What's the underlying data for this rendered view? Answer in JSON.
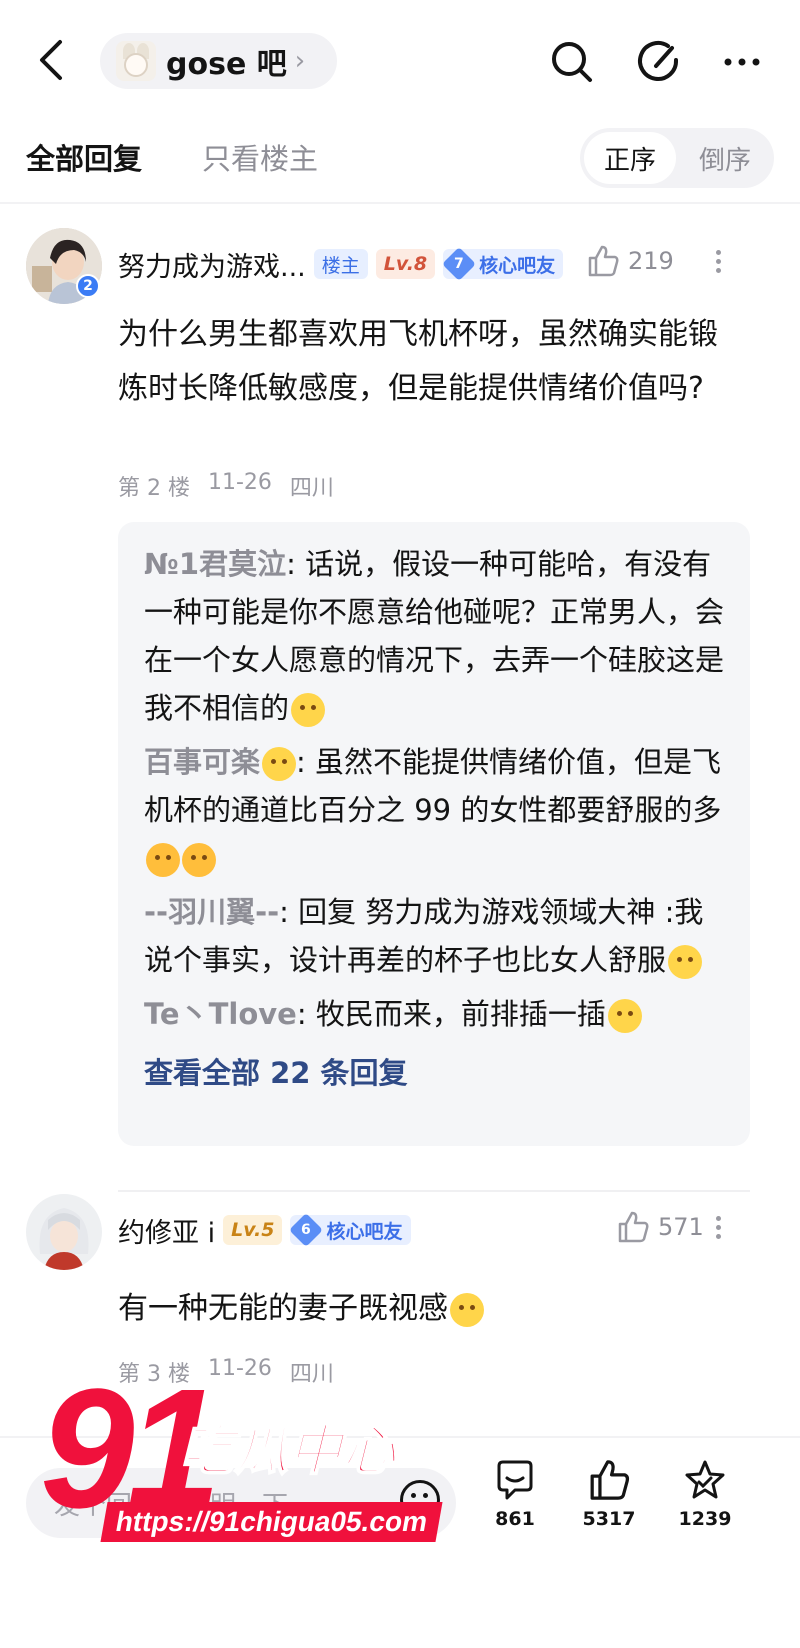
{
  "header": {
    "forum_name": "gose 吧",
    "forum_chevron": "›"
  },
  "tabs": {
    "all_replies": "全部回复",
    "op_only": "只看楼主",
    "order_asc": "正序",
    "order_desc": "倒序"
  },
  "post1": {
    "username": "努力成为游戏...",
    "avatar_badge": "2",
    "tag_op": "楼主",
    "tag_level": "Lv.8",
    "core_level": "7",
    "core_label": "核心吧友",
    "likes": "219",
    "content": "为什么男生都喜欢用飞机杯呀，虽然确实能锻炼时长降低敏感度，但是能提供情绪价值吗?",
    "floor": "第 2 楼",
    "date": "11-26",
    "location": "四川",
    "replies": [
      {
        "name": "№1君莫泣",
        "sep": ": ",
        "text": "话说，假设一种可能哈，有没有一种可能是你不愿意给他碰呢？正常男人，会在一个女人愿意的情况下，去弄一个硅胶这是我不相信的"
      },
      {
        "name": "百事可楽",
        "sep": ": ",
        "text": "虽然不能提供情绪价值，但是飞机杯的通道比百分之 99 的女性都要舒服的多"
      },
      {
        "name": "--羽川翼--",
        "sep": ": ",
        "text": "回复 努力成为游戏领域大神 :我说个事实，设计再差的杯子也比女人舒服"
      },
      {
        "name": "Te丶Tlove",
        "sep": ": ",
        "text": "牧民而来，前排插一插"
      }
    ],
    "view_all": "查看全部 22 条回复"
  },
  "post2": {
    "username": "约修亚 i",
    "tag_level": "Lv.5",
    "core_level": "6",
    "core_label": "核心吧友",
    "likes": "571",
    "content": "有一种无能的妻子既视感",
    "floor": "第 3 楼",
    "date": "11-26",
    "location": "四川"
  },
  "bottom": {
    "input_placeholder": "发个回复，说明一下",
    "comments": "861",
    "likes": "5317",
    "favorites": "1239"
  },
  "watermark": {
    "brand_number": "91",
    "brand_text": "吃瓜中心",
    "url": "https://91chigua05.com"
  },
  "colors": {
    "accent_blue": "#3b6fe6",
    "link_blue": "#2f4a86",
    "watermark_red": "#f0113c"
  }
}
